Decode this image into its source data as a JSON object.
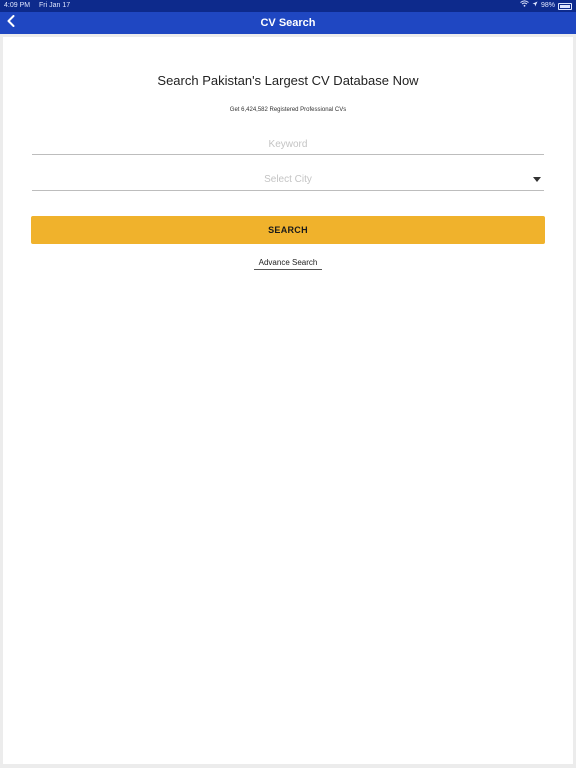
{
  "status_bar": {
    "time": "4:09 PM",
    "date": "Fri Jan 17",
    "battery_text": "98%",
    "battery_level": 0.98
  },
  "nav": {
    "title": "CV Search",
    "back_icon": "chevron-left-icon"
  },
  "main": {
    "headline": "Search Pakistan's Largest CV Database Now",
    "subline": "Get 6,424,582 Registered Professional CVs",
    "keyword_placeholder": "Keyword",
    "city_placeholder": "Select City",
    "search_label": "SEARCH",
    "advance_label": "Advance Search"
  },
  "colors": {
    "nav_bar": "#1f47c2",
    "status_bar": "#0d2a8c",
    "search_button": "#f0b22c",
    "background": "#ececec"
  }
}
